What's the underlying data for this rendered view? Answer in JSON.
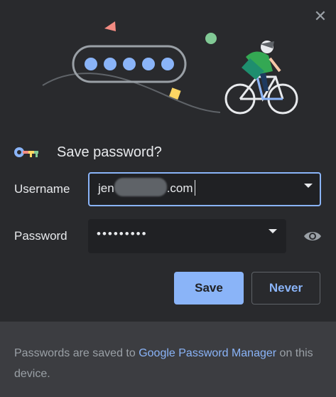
{
  "dialog": {
    "close_icon": "close-icon",
    "title": "Save password?",
    "username": {
      "label": "Username",
      "value_prefix": "jen",
      "value_suffix": ".com"
    },
    "password": {
      "label": "Password",
      "value": "•••••••••"
    },
    "save_label": "Save",
    "never_label": "Never",
    "footer": {
      "text_before": "Passwords are saved to ",
      "link": "Google Password Manager",
      "text_after": " on this device."
    }
  },
  "colors": {
    "accent": "#8ab4f8",
    "background": "#292a2d",
    "footer_bg": "#3c3d41"
  }
}
